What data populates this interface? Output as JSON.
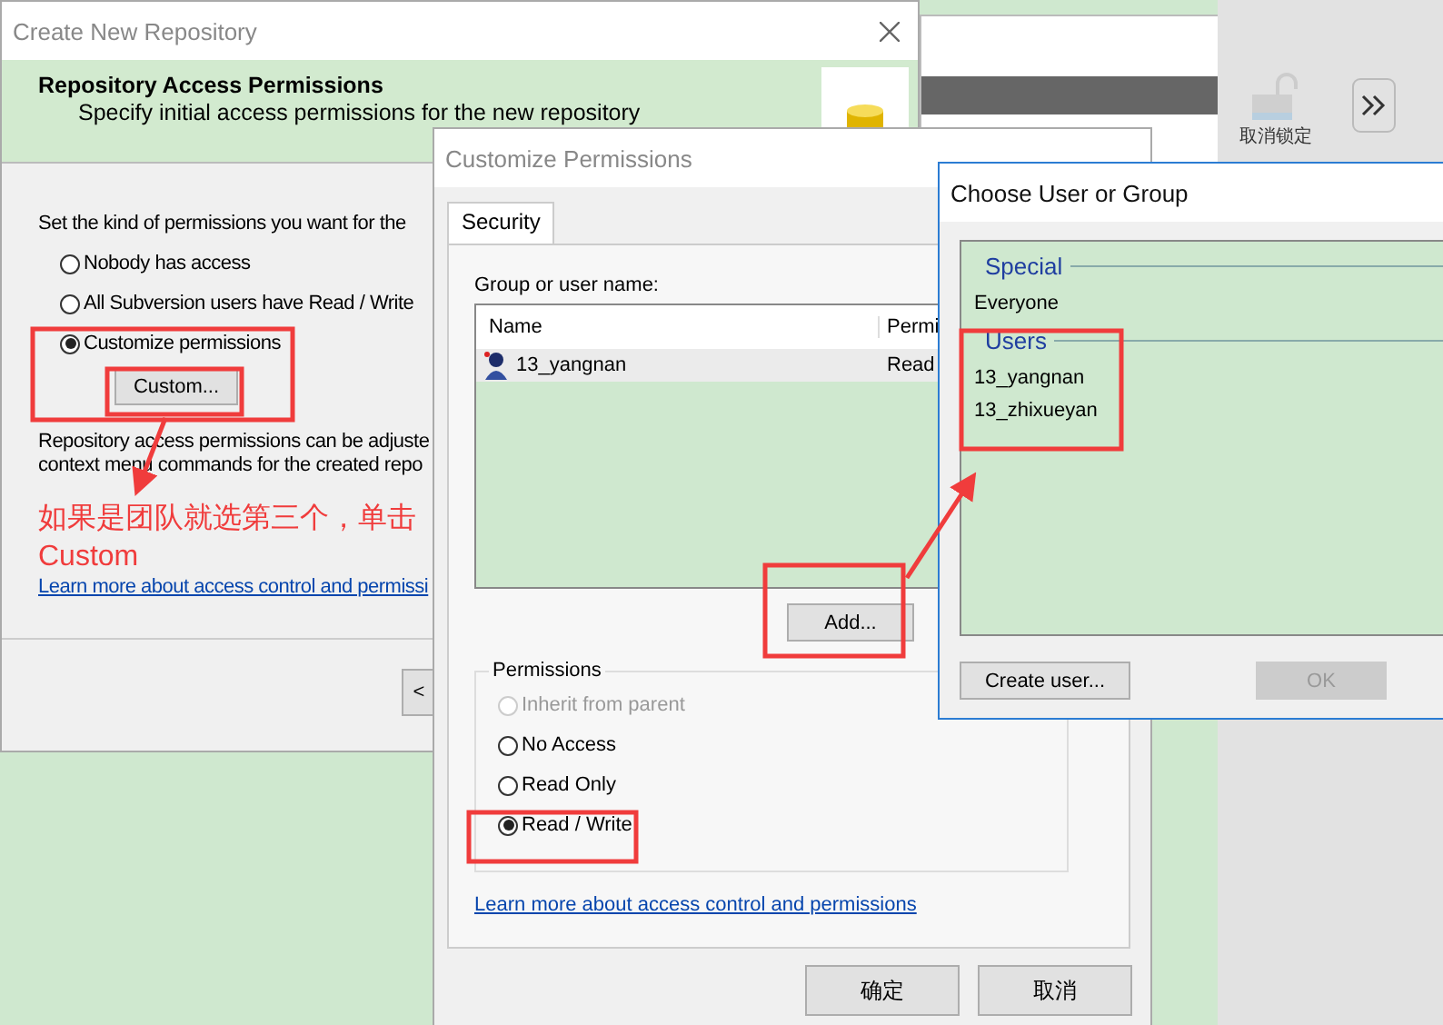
{
  "background_app": {
    "toolbar_label": "取消锁定"
  },
  "create_repository": {
    "title": "Create New Repository",
    "header_title": "Repository Access Permissions",
    "header_subtitle": "Specify initial access permissions for the new repository",
    "prompt": "Set the kind of permissions you want for the",
    "options": [
      {
        "label": "Nobody has access",
        "selected": false
      },
      {
        "label": "All Subversion users have Read / Write",
        "selected": false
      },
      {
        "label": "Customize permissions",
        "selected": true
      }
    ],
    "custom_button": "Custom...",
    "description": [
      "Repository access permissions can be adjuste",
      "context menu commands for the created repo"
    ],
    "link": "Learn more about access control and permissi",
    "back_button": "<"
  },
  "annotation": {
    "note": "如果是团队就选第三个，单击Custom"
  },
  "customize_permissions": {
    "title": "Customize Permissions",
    "tabs": [
      {
        "label": "Security",
        "selected": true
      }
    ],
    "group_label": "Group or user name:",
    "columns": [
      "Name",
      "Permi"
    ],
    "users": [
      {
        "name": "13_yangnan",
        "permission": "Read",
        "selected": true
      }
    ],
    "add_button": "Add...",
    "permissions_label": "Permissions",
    "options": [
      {
        "label": "Inherit from parent",
        "selected": false,
        "disabled": true
      },
      {
        "label": "No Access",
        "selected": false,
        "disabled": false
      },
      {
        "label": "Read Only",
        "selected": false,
        "disabled": false
      },
      {
        "label": "Read / Write",
        "selected": true,
        "disabled": false
      }
    ],
    "link": "Learn more about access control and permissions",
    "buttons": [
      "确定",
      "取消"
    ]
  },
  "choose_user": {
    "title": "Choose User or Group",
    "sections": [
      {
        "heading": "Special",
        "items": [
          "Everyone"
        ]
      },
      {
        "heading": "Users",
        "items": [
          "13_yangnan",
          "13_zhixueyan"
        ]
      }
    ],
    "create_button": "Create user...",
    "ok_button": {
      "label": "OK",
      "disabled": true
    }
  }
}
